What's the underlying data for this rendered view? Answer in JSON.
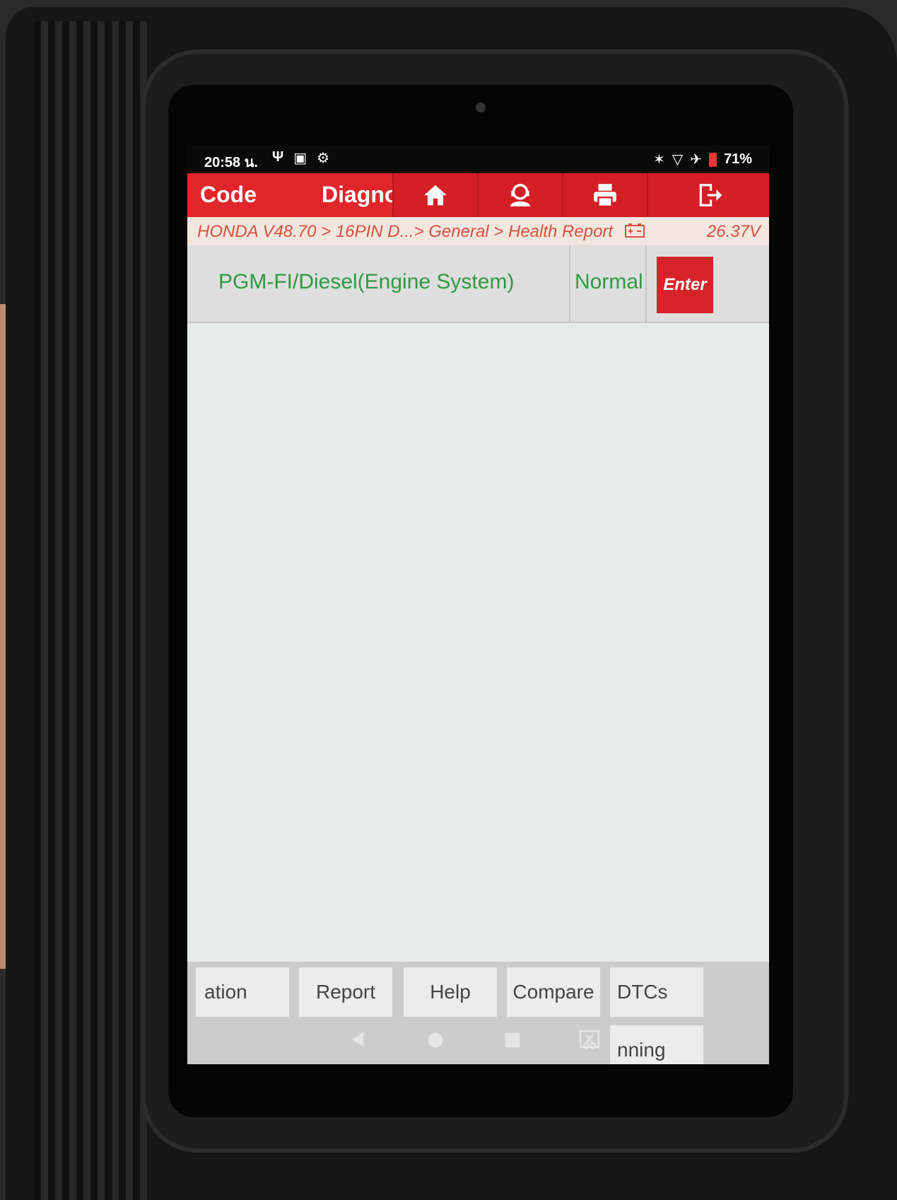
{
  "status_bar": {
    "time": "20:58 น.",
    "battery": "71%"
  },
  "header": {
    "tab_code": "Code",
    "tab_diagnose": "Diagnose",
    "icons": [
      "home-icon",
      "support-icon",
      "print-icon",
      "exit-icon"
    ]
  },
  "breadcrumb": {
    "path": "HONDA V48.70 > 16PIN D...> General > Health Report",
    "voltage": "26.37V"
  },
  "systems": [
    {
      "name": "PGM-FI/Diesel(Engine System)",
      "status": "Normal",
      "action": "Enter"
    }
  ],
  "toolbar": {
    "buttons": [
      "ation",
      "Report",
      "Help",
      "Compare",
      "DTCs",
      "nning"
    ]
  },
  "colors": {
    "accent": "#e0262b",
    "status_ok": "#2f9a40",
    "breadcrumb_text": "#d8533f"
  }
}
